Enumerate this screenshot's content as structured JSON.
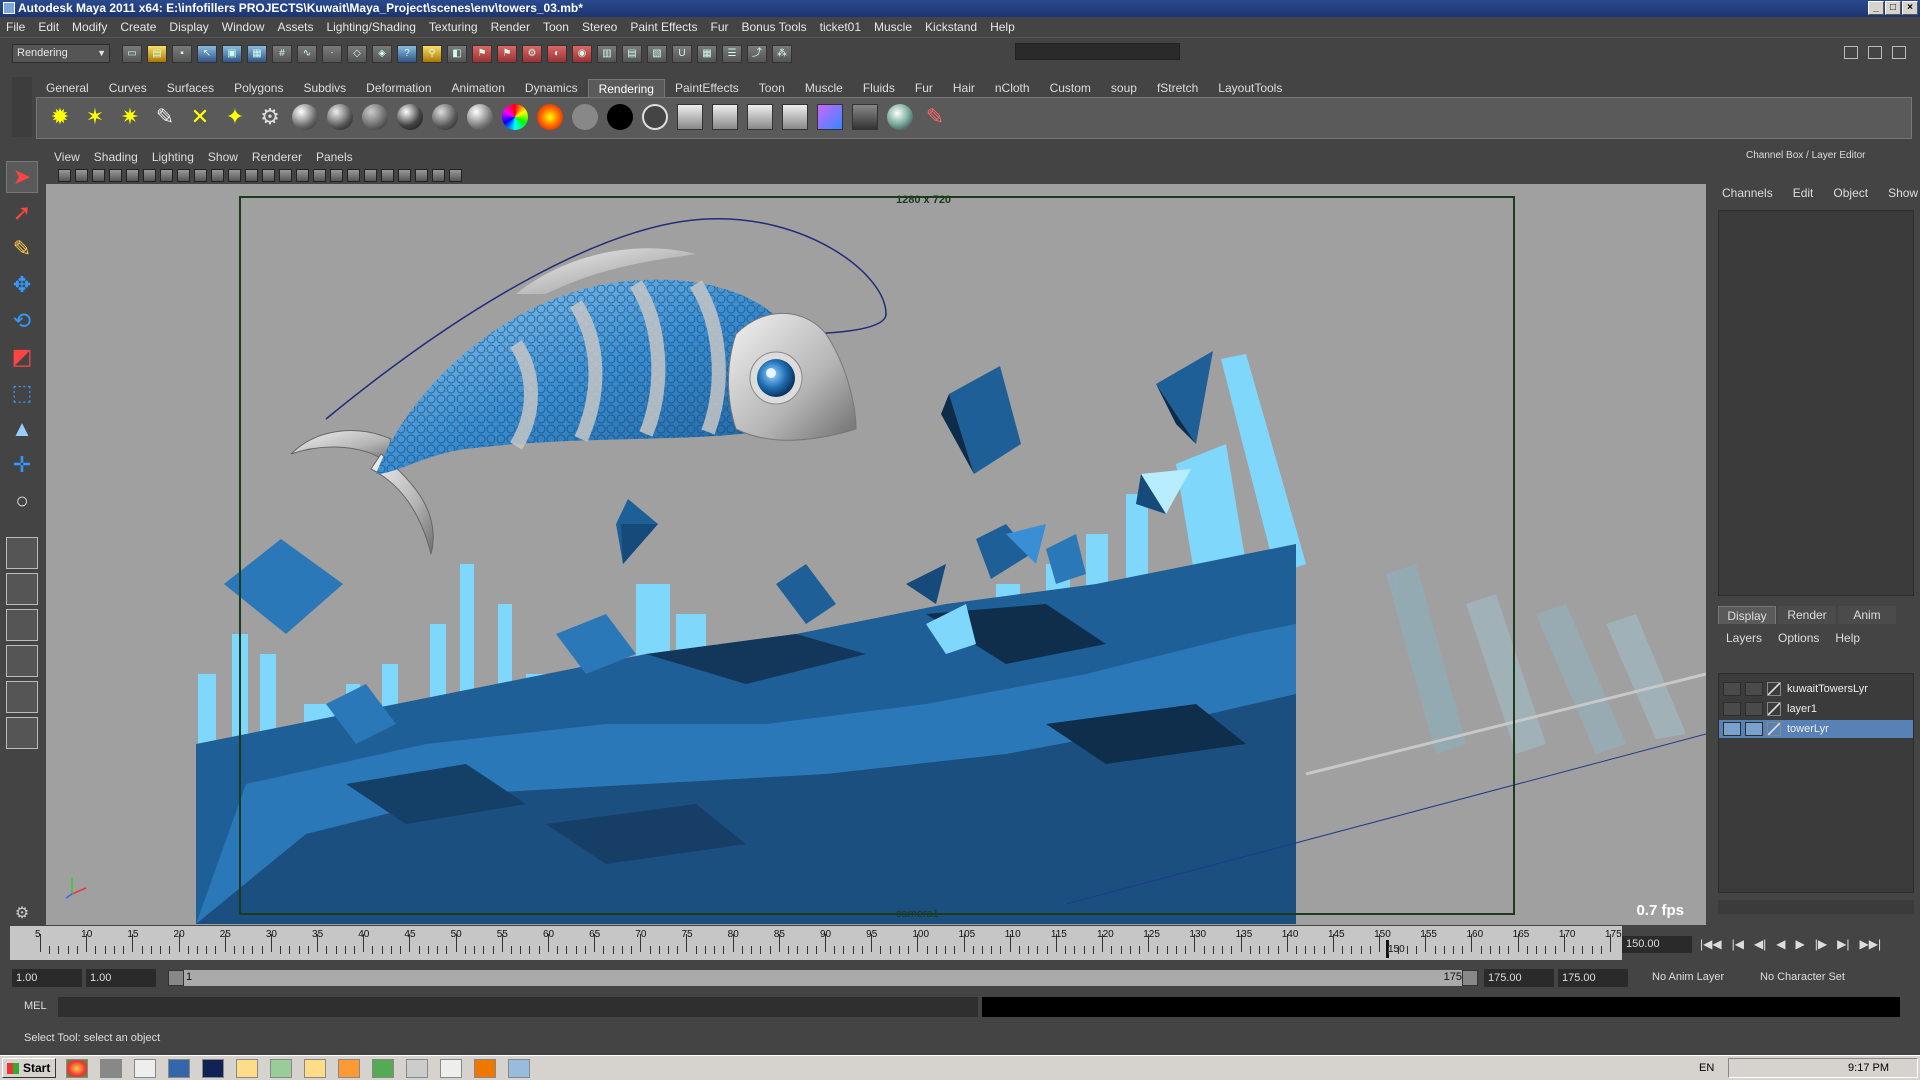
{
  "window": {
    "title": "Autodesk Maya 2011 x64: E:\\infofillers PROJECTS\\Kuwait\\Maya_Project\\scenes\\env\\towers_03.mb*"
  },
  "menu": [
    "File",
    "Edit",
    "Modify",
    "Create",
    "Display",
    "Window",
    "Assets",
    "Lighting/Shading",
    "Texturing",
    "Render",
    "Toon",
    "Stereo",
    "Paint Effects",
    "Fur",
    "Bonus Tools",
    "ticket01",
    "Muscle",
    "Kickstand",
    "Help"
  ],
  "status_line": {
    "mode": "Rendering"
  },
  "shelf": {
    "tabs": [
      "General",
      "Curves",
      "Surfaces",
      "Polygons",
      "Subdivs",
      "Deformation",
      "Animation",
      "Dynamics",
      "Rendering",
      "PaintEffects",
      "Toon",
      "Muscle",
      "Fluids",
      "Fur",
      "Hair",
      "nCloth",
      "Custom",
      "soup",
      "fStretch",
      "LayoutTools"
    ],
    "active_tab": "Rendering"
  },
  "viewport": {
    "menu": [
      "View",
      "Shading",
      "Lighting",
      "Show",
      "Renderer",
      "Panels"
    ],
    "resolution_label": "1280 x 720",
    "camera_label": "camera1",
    "fps": "0.7 fps"
  },
  "channel_box": {
    "title": "Channel Box / Layer Editor",
    "tabs": [
      "Channels",
      "Edit",
      "Object",
      "Show"
    ]
  },
  "layer_editor": {
    "tabs": [
      "Display",
      "Render",
      "Anim"
    ],
    "active_tab": "Display",
    "menu": [
      "Layers",
      "Options",
      "Help"
    ],
    "layers": [
      {
        "name": "kuwaitTowersLyr",
        "selected": false
      },
      {
        "name": "layer1",
        "selected": false
      },
      {
        "name": "towerLyr",
        "selected": true
      }
    ]
  },
  "timeline": {
    "ticks": [
      "5",
      "10",
      "15",
      "20",
      "25",
      "30",
      "35",
      "40",
      "45",
      "50",
      "55",
      "60",
      "65",
      "70",
      "75",
      "80",
      "85",
      "90",
      "95",
      "100",
      "105",
      "110",
      "115",
      "120",
      "125",
      "130",
      "135",
      "140",
      "145",
      "150",
      "155",
      "160",
      "165",
      "170",
      "175"
    ],
    "current_frame": "150",
    "current_field": "150.00"
  },
  "range": {
    "start": "1.00",
    "playback_start": "1.00",
    "slider_start": "1",
    "slider_end": "175",
    "playback_end": "175.00",
    "end": "175.00",
    "anim_layer": "No Anim Layer",
    "character_set": "No Character Set"
  },
  "command_line": {
    "label": "MEL"
  },
  "help_line": "Select Tool: select an object",
  "taskbar": {
    "start": "Start",
    "language": "EN",
    "clock": "9:17 PM"
  },
  "colors": {
    "viewport_bg": "#a0a0a0",
    "selected_layer": "#5882b5",
    "ui_bg": "#444444"
  }
}
